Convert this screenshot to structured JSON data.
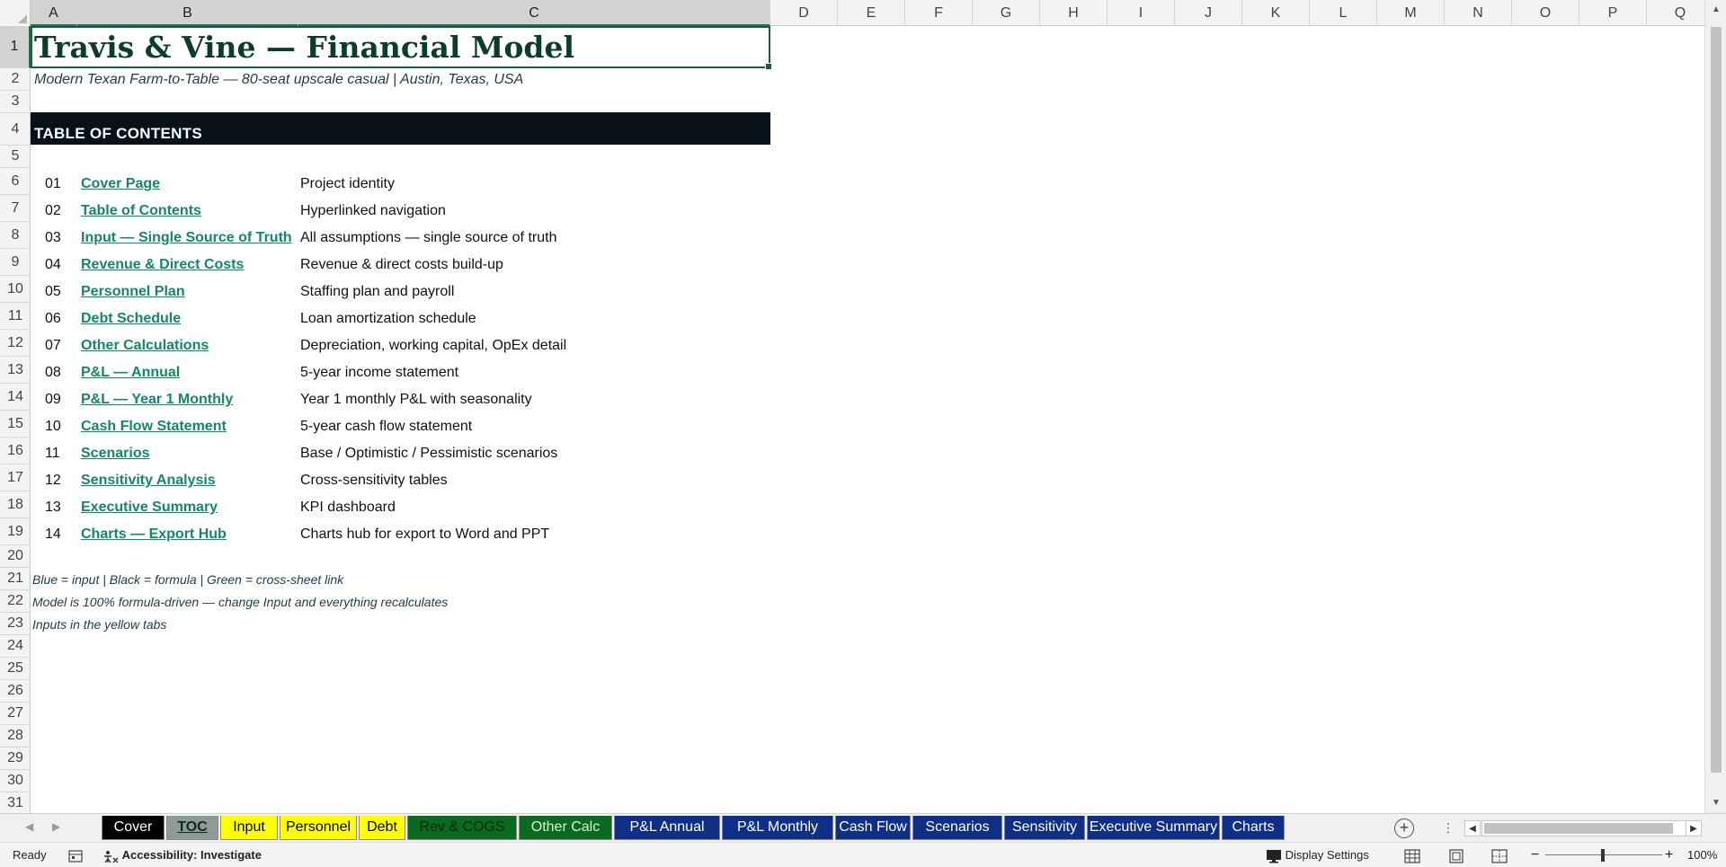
{
  "columns": [
    "A",
    "B",
    "C",
    "D",
    "E",
    "F",
    "G",
    "H",
    "I",
    "J",
    "K",
    "L",
    "M",
    "N",
    "O",
    "P",
    "Q"
  ],
  "rows": [
    "1",
    "2",
    "3",
    "4",
    "5",
    "6",
    "7",
    "8",
    "9",
    "10",
    "11",
    "12",
    "13",
    "14",
    "15",
    "16",
    "17",
    "18",
    "19",
    "20",
    "21",
    "22",
    "23",
    "24",
    "25",
    "26",
    "27",
    "28",
    "29",
    "30",
    "31"
  ],
  "sheet": {
    "title": "Travis & Vine — Financial Model",
    "subtitle": "Modern Texan Farm-to-Table — 80-seat upscale casual  |  Austin, Texas, USA",
    "toc_header": "TABLE OF CONTENTS",
    "toc": [
      {
        "num": "01",
        "link": "Cover Page",
        "desc": "Project identity"
      },
      {
        "num": "02",
        "link": "Table of Contents",
        "desc": "Hyperlinked navigation"
      },
      {
        "num": "03",
        "link": "Input — Single Source of Truth",
        "desc": "All assumptions — single source of truth"
      },
      {
        "num": "04",
        "link": "Revenue & Direct Costs",
        "desc": "Revenue & direct costs build-up"
      },
      {
        "num": "05",
        "link": "Personnel Plan",
        "desc": "Staffing plan and payroll"
      },
      {
        "num": "06",
        "link": "Debt Schedule",
        "desc": "Loan amortization schedule"
      },
      {
        "num": "07",
        "link": "Other Calculations",
        "desc": "Depreciation, working capital, OpEx detail"
      },
      {
        "num": "08",
        "link": "P&L — Annual",
        "desc": "5-year income statement"
      },
      {
        "num": "09",
        "link": "P&L — Year 1 Monthly",
        "desc": "Year 1 monthly P&L with seasonality"
      },
      {
        "num": "10",
        "link": "Cash Flow Statement",
        "desc": "5-year cash flow statement"
      },
      {
        "num": "11",
        "link": "Scenarios",
        "desc": "Base / Optimistic / Pessimistic scenarios"
      },
      {
        "num": "12",
        "link": "Sensitivity Analysis",
        "desc": "Cross-sensitivity tables"
      },
      {
        "num": "13",
        "link": "Executive Summary",
        "desc": "KPI dashboard"
      },
      {
        "num": "14",
        "link": "Charts — Export Hub",
        "desc": "Charts hub for export to Word and PPT"
      }
    ],
    "notes": [
      "Blue = input | Black = formula | Green = cross-sheet link",
      "Model is 100% formula-driven — change Input and everything recalculates",
      "Inputs in the yellow tabs"
    ]
  },
  "tabs": [
    {
      "label": "Cover",
      "bg": "#000000",
      "fg": "#ffffff"
    },
    {
      "label": "TOC",
      "bg": "#8f9a95",
      "fg": "#0b2a20",
      "active": true
    },
    {
      "label": "Input",
      "bg": "#ffff00",
      "fg": "#000000"
    },
    {
      "label": "Personnel",
      "bg": "#ffff00",
      "fg": "#000000"
    },
    {
      "label": "Debt",
      "bg": "#ffff00",
      "fg": "#000000"
    },
    {
      "label": "Rev & COGS",
      "bg": "#0a6a1f",
      "fg": "#0c2a0c"
    },
    {
      "label": "Other Calc",
      "bg": "#0a6a1f",
      "fg": "#d8f0d8"
    },
    {
      "label": "P&L Annual",
      "bg": "#0f2f86",
      "fg": "#ffffff"
    },
    {
      "label": "P&L Monthly",
      "bg": "#0f2f86",
      "fg": "#ffffff"
    },
    {
      "label": "Cash Flow",
      "bg": "#0f2f86",
      "fg": "#ffffff"
    },
    {
      "label": "Scenarios",
      "bg": "#0f2f86",
      "fg": "#ffffff"
    },
    {
      "label": "Sensitivity",
      "bg": "#0f2f86",
      "fg": "#ffffff"
    },
    {
      "label": "Executive Summary",
      "bg": "#0f2f86",
      "fg": "#ffffff"
    },
    {
      "label": "Charts",
      "bg": "#0f2f86",
      "fg": "#ffffff"
    }
  ],
  "status": {
    "ready": "Ready",
    "accessibility": "Accessibility: Investigate",
    "display_settings": "Display Settings",
    "zoom": "100%",
    "zoom_minus": "−",
    "zoom_plus": "+"
  },
  "icons": {
    "add_sheet": "+",
    "more": "⋮",
    "prev": "◀",
    "next": "▶",
    "up": "▲",
    "down": "▼"
  }
}
